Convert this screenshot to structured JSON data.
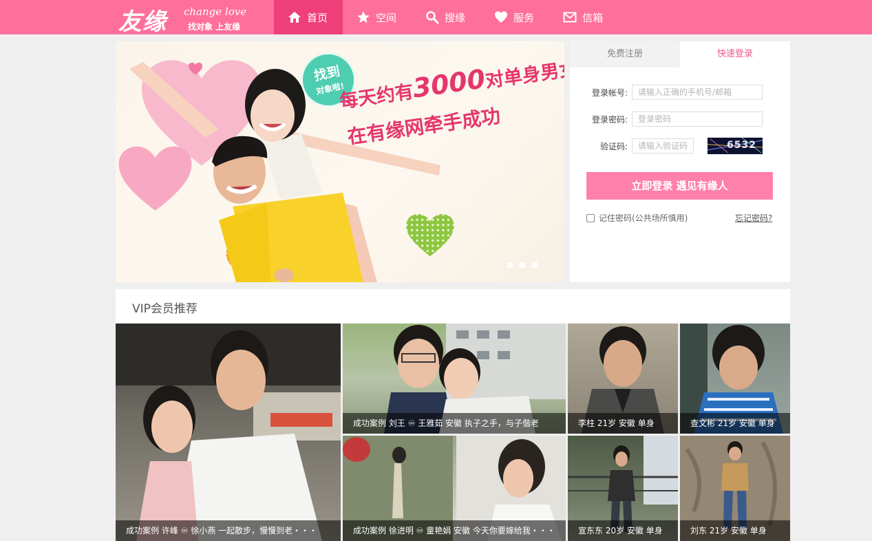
{
  "logo": {
    "cn": "友缘",
    "en": "change love",
    "tagline": "找对象 上友缘"
  },
  "nav": {
    "items": [
      {
        "label": "首页",
        "icon": "home-icon",
        "active": true
      },
      {
        "label": "空间",
        "icon": "star-icon",
        "active": false
      },
      {
        "label": "搜缘",
        "icon": "search-icon",
        "active": false
      },
      {
        "label": "服务",
        "icon": "heart-icon",
        "active": false
      },
      {
        "label": "信箱",
        "icon": "mail-icon",
        "active": false
      }
    ]
  },
  "banner": {
    "badge_line1": "找到",
    "badge_line2": "对象啦!",
    "slogan_prefix": "每天约有",
    "slogan_number": "3000",
    "slogan_suffix": "对单身男女",
    "slogan_line2": "在有缘网牵手成功",
    "slide_count": 3
  },
  "login": {
    "tab_register": "免费注册",
    "tab_login": "快速登录",
    "account_label": "登录帐号:",
    "account_placeholder": "请输入正确的手机号/邮箱",
    "password_label": "登录密码:",
    "password_placeholder": "登录密码",
    "captcha_label": "验证码:",
    "captcha_placeholder": "请输入验证码",
    "captcha_text": "6532",
    "submit_label": "立即登录 遇见有缘人",
    "remember_label": "记住密码(公共场所慎用)",
    "forgot_label": "忘记密码?"
  },
  "vip": {
    "title": "VIP会员推荐",
    "cards": [
      {
        "caption": "成功案例  许峰  ♾ 徐小燕  一起散步，慢慢到老・・・"
      },
      {
        "caption": "成功案例  刘王  ♾ 王雅茹  安徽  执子之手，与子偕老"
      },
      {
        "caption": "李柱  21岁  安徽  单身"
      },
      {
        "caption": "查文彬  21岁  安徽  单身"
      },
      {
        "caption": "成功案例  徐进明  ♾ 童艳娟  安徽  今天你要嫁给我・・・"
      },
      {
        "caption": "宣东东  20岁  安徽  单身"
      },
      {
        "caption": "刘东  21岁  安徽  单身"
      }
    ]
  },
  "colors": {
    "brand_pink": "#ff6f9c",
    "nav_active": "#ee3f7b",
    "button_pink": "#ff80ab"
  }
}
